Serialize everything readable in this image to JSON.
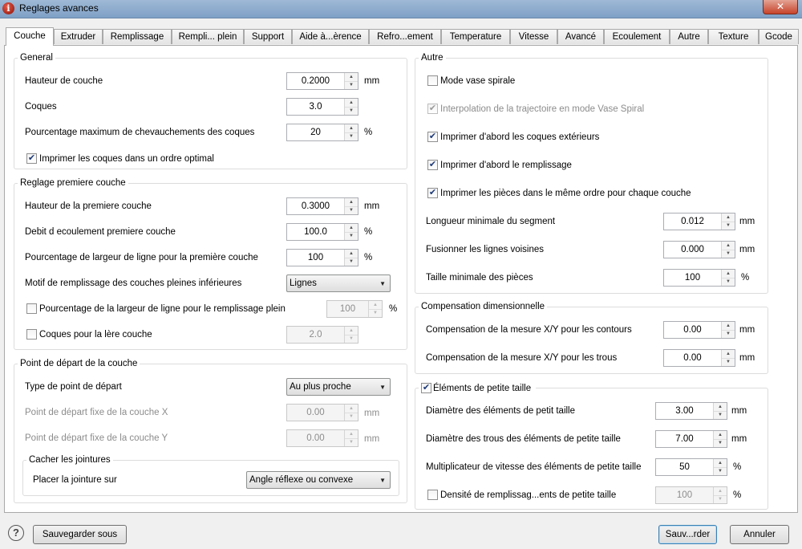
{
  "window": {
    "title": "Reglages avances",
    "app_icon_letter": "i",
    "close_glyph": "✕"
  },
  "tabs": [
    {
      "label": "Couche",
      "active": true
    },
    {
      "label": "Extruder"
    },
    {
      "label": "Remplissage"
    },
    {
      "label": "Rempli... plein"
    },
    {
      "label": "Support"
    },
    {
      "label": "Aide à...èrence"
    },
    {
      "label": "Refro...ement"
    },
    {
      "label": "Temperature"
    },
    {
      "label": "Vitesse"
    },
    {
      "label": "Avancé"
    },
    {
      "label": "Ecoulement"
    },
    {
      "label": "Autre"
    },
    {
      "label": "Texture"
    },
    {
      "label": "Gcode"
    }
  ],
  "general": {
    "title": "General",
    "layer_height": {
      "label": "Hauteur de couche",
      "value": "0.2000",
      "unit": "mm"
    },
    "shells": {
      "label": "Coques",
      "value": "3.0"
    },
    "max_overlap": {
      "label": "Pourcentage maximum de chevauchements des coques",
      "value": "20",
      "unit": "%"
    },
    "optimal_order": {
      "label": "Imprimer les coques dans un ordre optimal",
      "checked": true
    }
  },
  "first_layer": {
    "title": "Reglage premiere couche",
    "height": {
      "label": "Hauteur de la premiere couche",
      "value": "0.3000",
      "unit": "mm"
    },
    "flow": {
      "label": "Debit d ecoulement premiere couche",
      "value": "100.0",
      "unit": "%"
    },
    "line_width": {
      "label": "Pourcentage de largeur de ligne pour la première couche",
      "value": "100",
      "unit": "%"
    },
    "infill_pattern": {
      "label": "Motif de remplissage des couches pleines inférieures",
      "value": "Lignes"
    },
    "solid_line_width": {
      "label": "Pourcentage de la largeur de ligne pour le remplissage plein",
      "value": "100",
      "unit": "%",
      "checked": false
    },
    "first_layer_shells": {
      "label": "Coques pour la lère couche",
      "value": "2.0",
      "checked": false
    }
  },
  "start_point": {
    "title": "Point de départ de la couche",
    "type": {
      "label": "Type de point de départ",
      "value": "Au plus proche"
    },
    "fixed_x": {
      "label": "Point de départ fixe de la couche X",
      "value": "0.00",
      "unit": "mm"
    },
    "fixed_y": {
      "label": "Point de départ fixe de la couche Y",
      "value": "0.00",
      "unit": "mm"
    },
    "seams": {
      "title": "Cacher les jointures",
      "label": "Placer la jointure sur",
      "value": "Angle réflexe ou convexe"
    }
  },
  "other": {
    "title": "Autre",
    "spiral_vase": {
      "label": "Mode vase spirale",
      "checked": false
    },
    "spiral_interp": {
      "label": "Interpolation de la trajectoire en mode Vase Spiral",
      "checked": true
    },
    "outer_first": {
      "label": "Imprimer d'abord les coques extérieurs",
      "checked": true
    },
    "infill_first": {
      "label": "Imprimer d'abord le remplissage",
      "checked": true
    },
    "same_order": {
      "label": "Imprimer les pièces dans le même ordre pour chaque couche",
      "checked": true
    },
    "min_segment": {
      "label": "Longueur minimale du segment",
      "value": "0.012",
      "unit": "mm"
    },
    "merge_lines": {
      "label": "Fusionner les lignes voisines",
      "value": "0.000",
      "unit": "mm"
    },
    "min_part": {
      "label": "Taille minimale des pièces",
      "value": "100",
      "unit": "%"
    }
  },
  "compensation": {
    "title": "Compensation dimensionnelle",
    "contours": {
      "label": "Compensation de la mesure X/Y pour les contours",
      "value": "0.00",
      "unit": "mm"
    },
    "holes": {
      "label": "Compensation de la mesure X/Y pour les trous",
      "value": "0.00",
      "unit": "mm"
    }
  },
  "small_features": {
    "title": "Éléments de petite taille",
    "checked": true,
    "diameter": {
      "label": "Diamètre des éléments de petit taille",
      "value": "3.00",
      "unit": "mm"
    },
    "hole_diameter": {
      "label": "Diamètre des trous des éléments de petite taille",
      "value": "7.00",
      "unit": "mm"
    },
    "speed_mult": {
      "label": "Multiplicateur de vitesse des éléments de petite taille",
      "value": "50",
      "unit": "%"
    },
    "infill_density": {
      "label": "Densité de remplissag...ents de petite taille",
      "value": "100",
      "unit": "%",
      "checked": false
    }
  },
  "footer": {
    "help": "?",
    "save_as": "Sauvegarder sous",
    "save": "Sauv...rder",
    "cancel": "Annuler"
  },
  "glyphs": {
    "check": "✔",
    "up": "▲",
    "down": "▼",
    "dropdown": "▼"
  }
}
